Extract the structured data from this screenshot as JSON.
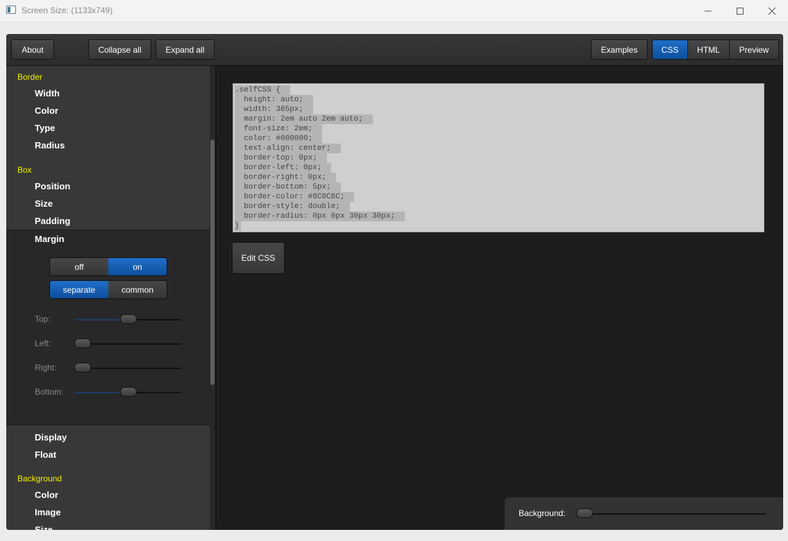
{
  "window": {
    "title": "Screen Size: (1133x749)"
  },
  "toolbar": {
    "about": "About",
    "collapse_all": "Collapse all",
    "expand_all": "Expand all",
    "examples": "Examples",
    "tabs": [
      {
        "label": "CSS",
        "active": true
      },
      {
        "label": "HTML",
        "active": false
      },
      {
        "label": "Preview",
        "active": false
      }
    ]
  },
  "sidebar": {
    "border": {
      "label": "Border",
      "items": [
        "Width",
        "Color",
        "Type",
        "Radius"
      ]
    },
    "box": {
      "label": "Box",
      "items": [
        "Position",
        "Size",
        "Padding",
        "Margin",
        "Display",
        "Float"
      ]
    },
    "background": {
      "label": "Background",
      "items": [
        "Color",
        "Image",
        "Size"
      ]
    },
    "margin": {
      "toggle": {
        "off": "off",
        "on": "on",
        "selected": "on"
      },
      "mode": {
        "separate": "separate",
        "common": "common",
        "selected": "separate"
      },
      "sliders": [
        {
          "label": "Top:",
          "value": 0.5
        },
        {
          "label": "Left:",
          "value": 0.0
        },
        {
          "label": "Right:",
          "value": 0.0
        },
        {
          "label": "Bottom:",
          "value": 0.5
        }
      ]
    }
  },
  "code": {
    "lines": [
      ".selfCSS {",
      "  height: auto;",
      "  width: 365px;",
      "  margin: 2em auto 2em auto;",
      "  font-size: 2em;",
      "  color: #000000;",
      "  text-align: center;",
      "  border-top: 0px;",
      "  border-left: 0px;",
      "  border-right: 0px;",
      "  border-bottom: 5px;",
      "  border-color: #8C8C8C;",
      "  border-style: double;",
      "  border-radius: 0px 0px 30px 30px;",
      "}"
    ]
  },
  "edit_css": "Edit CSS",
  "background_panel": {
    "label": "Background:",
    "value": 0.0
  },
  "colors": {
    "accent": "#1565c0",
    "category": "#f3f000",
    "panel": "#383838",
    "content": "#1d1d1d"
  }
}
